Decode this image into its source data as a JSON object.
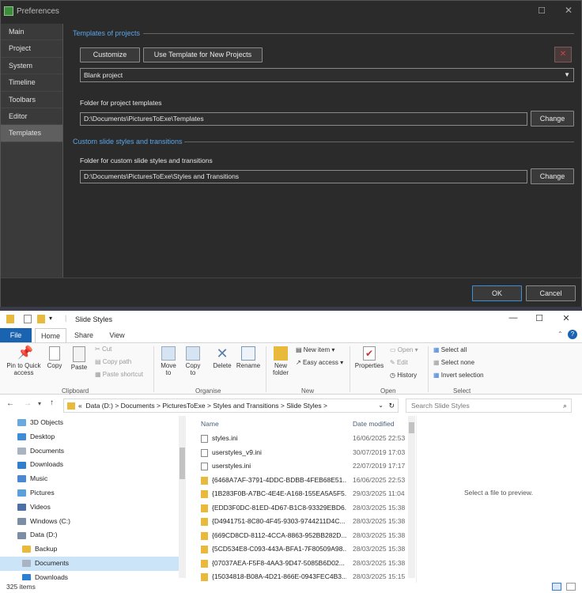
{
  "preferences": {
    "title": "Preferences",
    "nav_items": [
      "Main",
      "Project",
      "System",
      "Timeline",
      "Toolbars",
      "Editor",
      "Templates"
    ],
    "selected_nav": "Templates",
    "templates_group": "Templates of projects",
    "customize_label": "Customize",
    "use_template_label": "Use Template for New Projects",
    "template_select_value": "Blank project",
    "project_folder_label": "Folder for project templates",
    "project_folder_value": "D:\\Documents\\PicturesToExe\\Templates",
    "change_label": "Change",
    "custom_group": "Custom slide styles and transitions",
    "styles_folder_label": "Folder for custom slide styles and transitions",
    "styles_folder_value": "D:\\Documents\\PicturesToExe\\Styles and Transitions",
    "ok_label": "OK",
    "cancel_label": "Cancel"
  },
  "explorer": {
    "title": "Slide Styles",
    "tabs": {
      "file": "File",
      "home": "Home",
      "share": "Share",
      "view": "View"
    },
    "ribbon": {
      "pin": "Pin to Quick access",
      "copy": "Copy",
      "paste": "Paste",
      "cut": "Cut",
      "copy_path": "Copy path",
      "paste_shortcut": "Paste shortcut",
      "clipboard": "Clipboard",
      "move_to": "Move to",
      "copy_to": "Copy to",
      "delete": "Delete",
      "rename": "Rename",
      "organise": "Organise",
      "new_item": "New item",
      "easy_access": "Easy access",
      "new_folder": "New folder",
      "new": "New",
      "properties": "Properties",
      "open": "Open",
      "edit": "Edit",
      "history": "History",
      "open_group": "Open",
      "select_all": "Select all",
      "select_none": "Select none",
      "invert_selection": "Invert selection",
      "select": "Select"
    },
    "address": {
      "prefix": "«",
      "crumbs": [
        "Data (D:)",
        "Documents",
        "PicturesToExe",
        "Styles and Transitions",
        "Slide Styles"
      ],
      "search_placeholder": "Search Slide Styles"
    },
    "nav_pane": [
      "3D Objects",
      "Desktop",
      "Documents",
      "Downloads",
      "Music",
      "Pictures",
      "Videos",
      "Windows (C:)",
      "Data (D:)",
      "Backup",
      "Documents",
      "Downloads"
    ],
    "columns": {
      "name": "Name",
      "date": "Date modified"
    },
    "files": [
      {
        "name": "styles.ini",
        "date": "16/06/2025 22:53",
        "kind": "file"
      },
      {
        "name": "userstyles_v9.ini",
        "date": "30/07/2019 17:03",
        "kind": "file"
      },
      {
        "name": "userstyles.ini",
        "date": "22/07/2019 17:17",
        "kind": "file"
      },
      {
        "name": "{6468A7AF-3791-4DDC-BDBB-4FEB68E51...",
        "date": "16/06/2025 22:53",
        "kind": "folder"
      },
      {
        "name": "{1B283F0B-A7BC-4E4E-A168-155EA5A5F5...",
        "date": "29/03/2025 11:04",
        "kind": "folder"
      },
      {
        "name": "{EDD3F0DC-81ED-4D67-B1C8-93329EBD6...",
        "date": "28/03/2025 15:38",
        "kind": "folder"
      },
      {
        "name": "{D4941751-8C80-4F45-9303-9744211D4C...",
        "date": "28/03/2025 15:38",
        "kind": "folder"
      },
      {
        "name": "{669CD8CD-8112-4CCA-8863-952BB282D...",
        "date": "28/03/2025 15:38",
        "kind": "folder"
      },
      {
        "name": "{5CD534E8-C093-443A-BFA1-7F80509A98...",
        "date": "28/03/2025 15:38",
        "kind": "folder"
      },
      {
        "name": "{07037AEA-F5F8-4AA3-9D47-5085B6D02...",
        "date": "28/03/2025 15:38",
        "kind": "folder"
      },
      {
        "name": "{15034818-B08A-4D21-866E-0943FEC4B3...",
        "date": "28/03/2025 15:15",
        "kind": "folder"
      }
    ],
    "preview_text": "Select a file to preview.",
    "status_text": "325 items"
  }
}
